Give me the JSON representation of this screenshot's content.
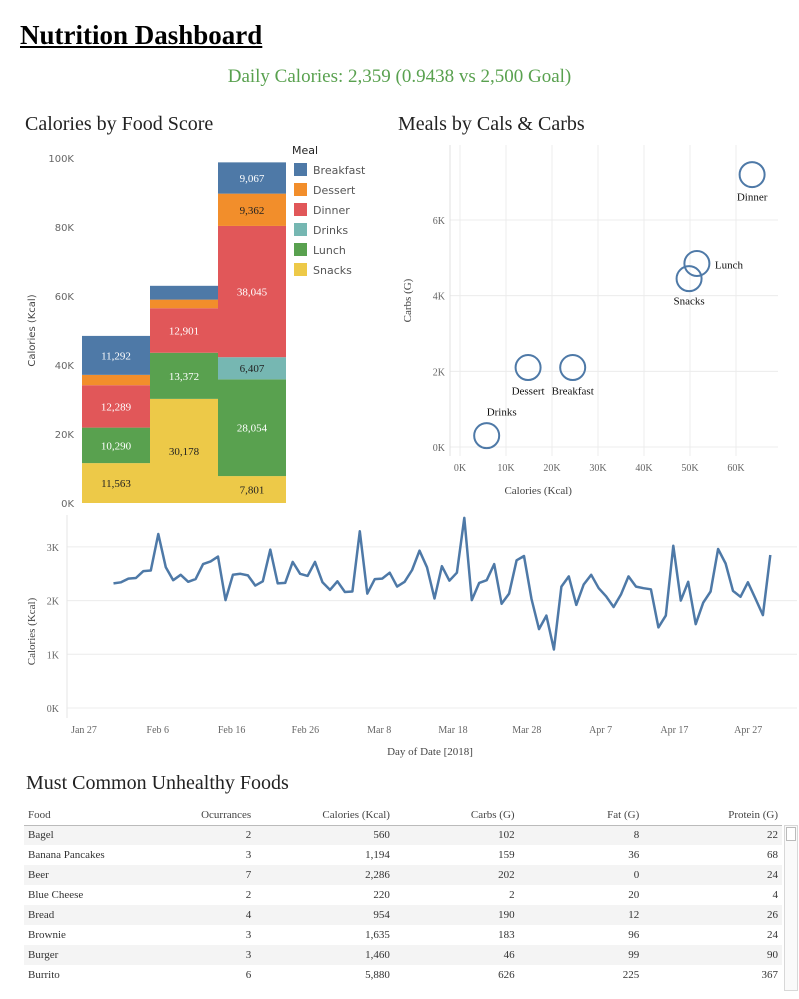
{
  "title": "Nutrition Dashboard",
  "summary": "Daily Calories: 2,359 (0.9438 vs 2,500 Goal)",
  "sections": {
    "food_score": "Calories by Food Score",
    "meals_scatter": "Meals by Cals & Carbs",
    "table": "Must Common Unhealthy Foods"
  },
  "colors": {
    "Breakfast": "#4e79a7",
    "Dessert": "#f28e2b",
    "Dinner": "#e15759",
    "Drinks": "#76b7b2",
    "Lunch": "#59a14f",
    "Snacks": "#edc948",
    "summary": "#59a14f",
    "line": "#4e79a7"
  },
  "chart_data": [
    {
      "type": "bar",
      "stacked": true,
      "title": "Calories by Food Score",
      "ylabel": "Calories (Kcal)",
      "ylim": [
        0,
        100000
      ],
      "yticks": [
        "0K",
        "20K",
        "40K",
        "60K",
        "80K",
        "100K"
      ],
      "legend": {
        "title": "Meal",
        "position": "top-right",
        "items": [
          "Breakfast",
          "Dessert",
          "Dinner",
          "Drinks",
          "Lunch",
          "Snacks"
        ]
      },
      "categories": [
        "",
        "",
        ""
      ],
      "series": [
        {
          "name": "Snacks",
          "values": [
            11563,
            30178,
            7801
          ],
          "labels": [
            "11,563",
            "30,178",
            "7,801"
          ]
        },
        {
          "name": "Lunch",
          "values": [
            10290,
            13372,
            28054
          ],
          "labels": [
            "10,290",
            "13,372",
            "28,054"
          ]
        },
        {
          "name": "Drinks",
          "values": [
            0,
            0,
            6407
          ],
          "labels": [
            "",
            "",
            "6,407"
          ]
        },
        {
          "name": "Dinner",
          "values": [
            12289,
            12901,
            38045
          ],
          "labels": [
            "12,289",
            "12,901",
            "38,045"
          ]
        },
        {
          "name": "Dessert",
          "values": [
            3000,
            2500,
            9362
          ],
          "labels": [
            "",
            "",
            "9,362"
          ]
        },
        {
          "name": "Breakfast",
          "values": [
            11292,
            4000,
            9067
          ],
          "labels": [
            "11,292",
            "",
            "9,067"
          ]
        }
      ]
    },
    {
      "type": "scatter",
      "title": "Meals by Cals & Carbs",
      "xlabel": "Calories (Kcal)",
      "ylabel": "Carbs (G)",
      "xlim": [
        0,
        65000
      ],
      "ylim": [
        0,
        7000
      ],
      "xticks": [
        "0K",
        "10K",
        "20K",
        "30K",
        "40K",
        "50K",
        "60K"
      ],
      "yticks": [
        "0K",
        "2K",
        "4K",
        "6K"
      ],
      "points": [
        {
          "label": "Dinner",
          "x": 63500,
          "y": 7200
        },
        {
          "label": "Lunch",
          "x": 51500,
          "y": 4850
        },
        {
          "label": "Snacks",
          "x": 49800,
          "y": 4450
        },
        {
          "label": "Dessert",
          "x": 14800,
          "y": 2100
        },
        {
          "label": "Breakfast",
          "x": 24500,
          "y": 2100
        },
        {
          "label": "Drinks",
          "x": 5800,
          "y": 300
        }
      ]
    },
    {
      "type": "line",
      "xlabel": "Day of Date [2018]",
      "ylabel": "Calories (Kcal)",
      "ylim": [
        0,
        3600
      ],
      "yticks": [
        "0K",
        "1K",
        "2K",
        "3K"
      ],
      "xticks": [
        "Jan 27",
        "Feb 6",
        "Feb 16",
        "Feb 26",
        "Mar 8",
        "Mar 18",
        "Mar 28",
        "Apr 7",
        "Apr 17",
        "Apr 27"
      ],
      "x_start": "2018-01-31",
      "x_end": "2018-04-30",
      "series": [
        {
          "values": [
            2320,
            2340,
            2410,
            2420,
            2550,
            2560,
            3240,
            2620,
            2380,
            2480,
            2350,
            2400,
            2680,
            2730,
            2820,
            2010,
            2480,
            2500,
            2470,
            2280,
            2360,
            2950,
            2320,
            2330,
            2720,
            2500,
            2460,
            2720,
            2340,
            2200,
            2360,
            2160,
            2170,
            3290,
            2130,
            2400,
            2410,
            2520,
            2260,
            2350,
            2570,
            2930,
            2620,
            2040,
            2640,
            2370,
            2520,
            3540,
            2010,
            2330,
            2380,
            2680,
            1940,
            2130,
            2750,
            2830,
            2030,
            1470,
            1720,
            1090,
            2260,
            2450,
            1920,
            2300,
            2480,
            2230,
            2080,
            1880,
            2120,
            2450,
            2260,
            2230,
            2210,
            1500,
            1720,
            3020,
            2000,
            2350,
            1560,
            1960,
            2170,
            2960,
            2690,
            2180,
            2070,
            2340,
            2040,
            1730,
            2850
          ]
        }
      ]
    }
  ],
  "table": {
    "columns": [
      "Food",
      "Ocurrances",
      "Calories (Kcal)",
      "Carbs (G)",
      "Fat (G)",
      "Protein (G)"
    ],
    "rows": [
      [
        "Bagel",
        "2",
        "560",
        "102",
        "8",
        "22"
      ],
      [
        "Banana Pancakes",
        "3",
        "1,194",
        "159",
        "36",
        "68"
      ],
      [
        "Beer",
        "7",
        "2,286",
        "202",
        "0",
        "24"
      ],
      [
        "Blue Cheese",
        "2",
        "220",
        "2",
        "20",
        "4"
      ],
      [
        "Bread",
        "4",
        "954",
        "190",
        "12",
        "26"
      ],
      [
        "Brownie",
        "3",
        "1,635",
        "183",
        "96",
        "24"
      ],
      [
        "Burger",
        "3",
        "1,460",
        "46",
        "99",
        "90"
      ],
      [
        "Burrito",
        "6",
        "5,880",
        "626",
        "225",
        "367"
      ]
    ]
  }
}
